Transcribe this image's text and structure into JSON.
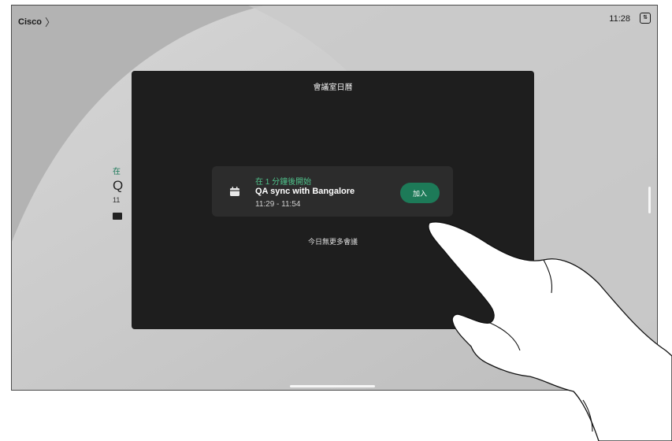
{
  "status_bar": {
    "brand": "Cisco",
    "chevron": "〉",
    "time": "11:28",
    "right_icon": "panel-toggle-icon",
    "right_icon_glyph": "⇅"
  },
  "background_meeting": {
    "status_fragment": "在",
    "title_fragment": "Q",
    "time_fragment": "11"
  },
  "dialog": {
    "title": "會議室日曆",
    "meeting": {
      "status": "在 1 分鐘後開始",
      "title": "QA sync with Bangalore",
      "time": "11:29 - 11:54",
      "icon": "calendar-icon"
    },
    "join_label": "加入",
    "no_more_label": "今日無更多會議"
  },
  "colors": {
    "dialog_bg": "#1e1e1e",
    "card_bg": "#2c2c2c",
    "accent_green": "#1d7a58",
    "status_green": "#4fc08a"
  }
}
